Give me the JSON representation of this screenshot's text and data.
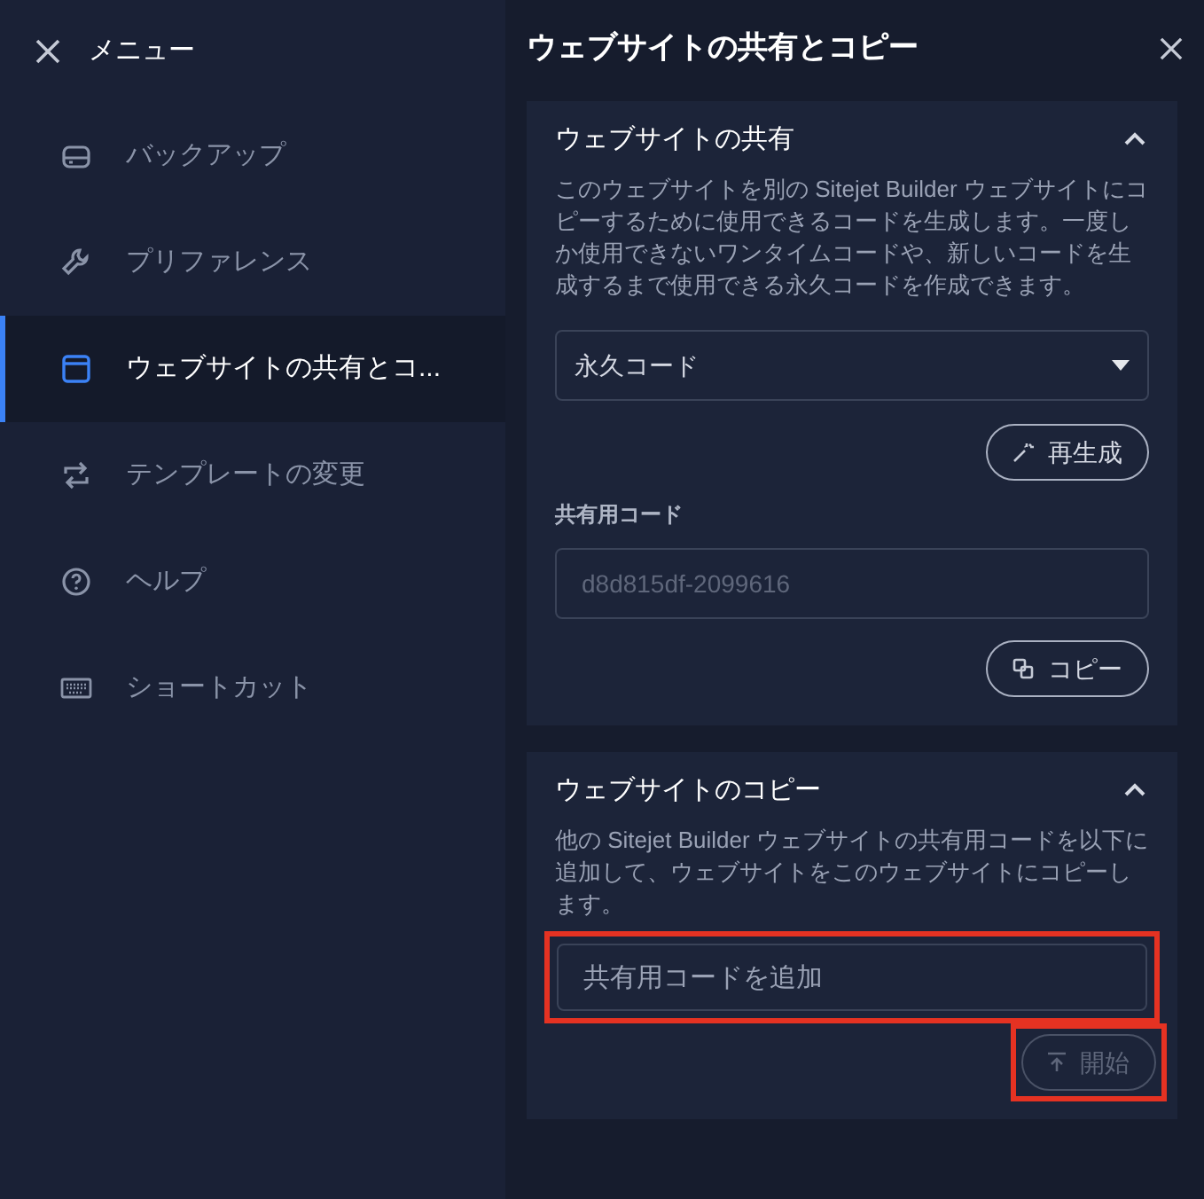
{
  "sidebar": {
    "title": "メニュー",
    "items": [
      {
        "kind": "backup",
        "label": "バックアップ",
        "selected": false
      },
      {
        "kind": "wrench",
        "label": "プリファレンス",
        "selected": false
      },
      {
        "kind": "window",
        "label": "ウェブサイトの共有とコ...",
        "selected": true
      },
      {
        "kind": "swap",
        "label": "テンプレートの変更",
        "selected": false
      },
      {
        "kind": "help",
        "label": "ヘルプ",
        "selected": false
      },
      {
        "kind": "keyboard",
        "label": "ショートカット",
        "selected": false
      }
    ]
  },
  "panel": {
    "title": "ウェブサイトの共有とコピー",
    "share": {
      "title": "ウェブサイトの共有",
      "expanded": true,
      "description": "このウェブサイトを別の Sitejet Builder ウェブサイトにコピーするために使用できるコードを生成します。一度しか使用できないワンタイムコードや、新しいコードを生成するまで使用できる永久コードを作成できます。",
      "select_value": "永久コード",
      "regenerate_button": "再生成",
      "code_label": "共有用コード",
      "code_value": "d8d815df-2099616",
      "copy_button": "コピー"
    },
    "copy": {
      "title": "ウェブサイトのコピー",
      "expanded": true,
      "description": "他の Sitejet Builder ウェブサイトの共有用コードを以下に追加して、ウェブサイトをこのウェブサイトにコピーします。",
      "placeholder": "共有用コードを追加",
      "input_highlighted": true,
      "start_button": "開始",
      "start_disabled": true,
      "start_highlighted": true
    }
  }
}
